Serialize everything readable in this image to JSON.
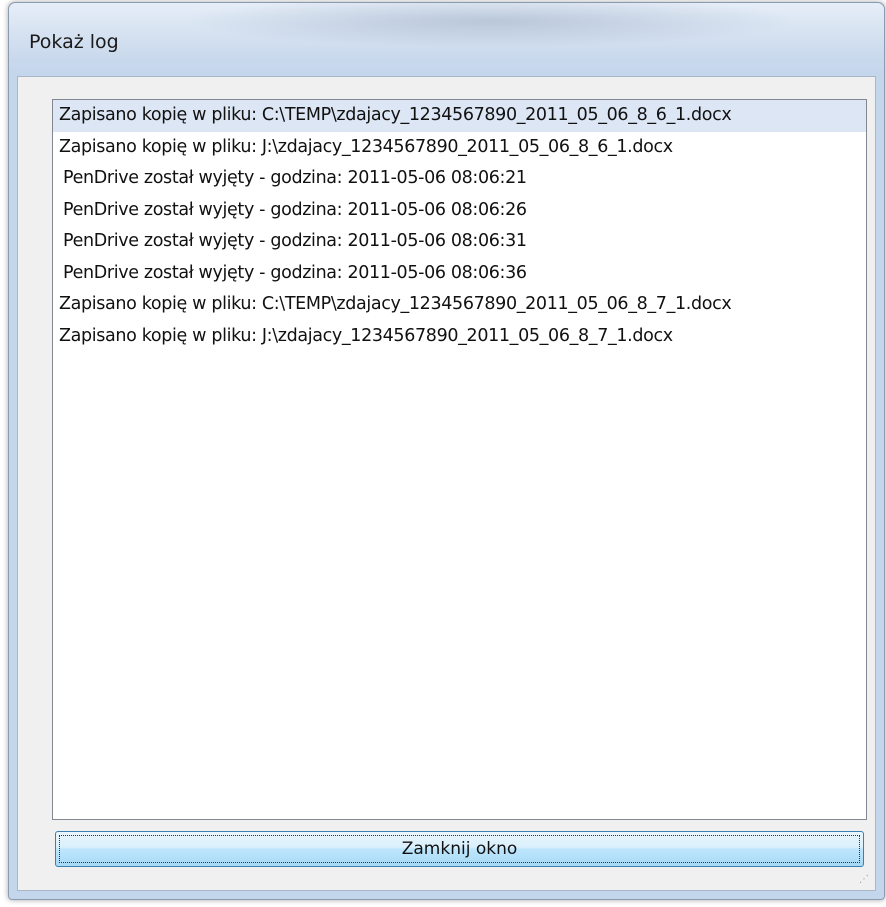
{
  "window": {
    "title": "Pokaż log"
  },
  "log": {
    "entries": [
      "Zapisano kopię w pliku: C:\\TEMP\\zdajacy_1234567890_2011_05_06_8_6_1.docx",
      "Zapisano kopię w pliku: J:\\zdajacy_1234567890_2011_05_06_8_6_1.docx",
      "PenDrive został wyjęty - godzina: 2011-05-06 08:06:21",
      "PenDrive został wyjęty - godzina: 2011-05-06 08:06:26",
      "PenDrive został wyjęty - godzina: 2011-05-06 08:06:31",
      "PenDrive został wyjęty - godzina: 2011-05-06 08:06:36",
      "Zapisano kopię w pliku: C:\\TEMP\\zdajacy_1234567890_2011_05_06_8_7_1.docx",
      "Zapisano kopię w pliku: J:\\zdajacy_1234567890_2011_05_06_8_7_1.docx"
    ],
    "selected_index": 0
  },
  "buttons": {
    "close_label": "Zamknij okno"
  },
  "icons": {
    "resize_grip": "resize-grip-icon"
  },
  "colors": {
    "selection": "#dce6f4",
    "button_border": "#3c7fb1",
    "window_frame": "#c4d6ec"
  }
}
